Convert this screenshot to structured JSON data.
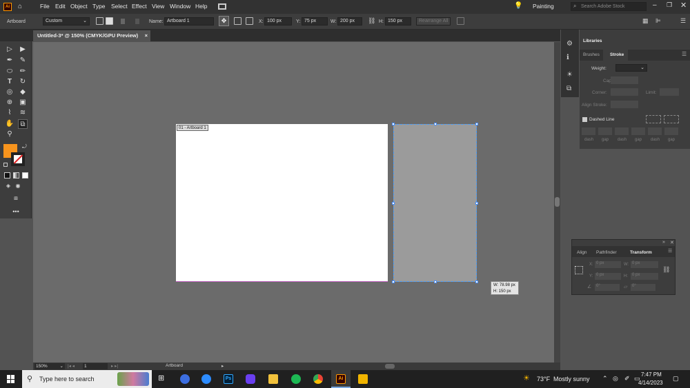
{
  "menu": {
    "items": [
      "File",
      "Edit",
      "Object",
      "Type",
      "Select",
      "Effect",
      "View",
      "Window",
      "Help"
    ],
    "workspace": "Painting",
    "search_placeholder": "Search Adobe Stock"
  },
  "control": {
    "selection": "Artboard",
    "preset": "Custom",
    "name_label": "Name:",
    "name_value": "Artboard 1",
    "x_label": "X:",
    "x_value": "100 px",
    "y_label": "Y:",
    "y_value": "75 px",
    "w_label": "W:",
    "w_value": "200 px",
    "h_label": "H:",
    "h_value": "150 px",
    "rearrange": "Rearrange All"
  },
  "document": {
    "tab": "Untitled-3* @ 150% (CMYK/GPU Preview)",
    "artboard_label": "01 - Artboard 1"
  },
  "tooltip": {
    "w": "W: 78.98 px",
    "h": "H: 150 px"
  },
  "status": {
    "zoom": "150%",
    "page": "1",
    "tool": "Artboard"
  },
  "libraries": {
    "title": "Libraries",
    "tabs": [
      "Brushes",
      "Stroke"
    ],
    "weight_label": "Weight:",
    "cap_label": "Cap:",
    "corner_label": "Corner:",
    "limit_label": "Limit:",
    "align_stroke_label": "Align Stroke:",
    "dashed_label": "Dashed Line",
    "dash_labels": [
      "dash",
      "gap",
      "dash",
      "gap",
      "dash",
      "gap"
    ]
  },
  "transform_panel": {
    "tabs": [
      "Align",
      "Pathfinder",
      "Transform"
    ],
    "x": "0 px",
    "y": "0 px",
    "w": "0 px",
    "h": "0 px",
    "x_label": "X:",
    "y_label": "Y:",
    "w_label": "W:",
    "h_label": "H:",
    "angle": "0°",
    "shear": "0°"
  },
  "taskbar": {
    "search_placeholder": "Type here to search",
    "weather_temp": "73°F",
    "weather_text": "Mostly sunny",
    "time": "7:47 PM",
    "date": "4/14/2023",
    "ps": "Ps",
    "ai": "Ai"
  },
  "colors": {
    "fill": "#f7941d",
    "accent": "#4aa0ff"
  }
}
